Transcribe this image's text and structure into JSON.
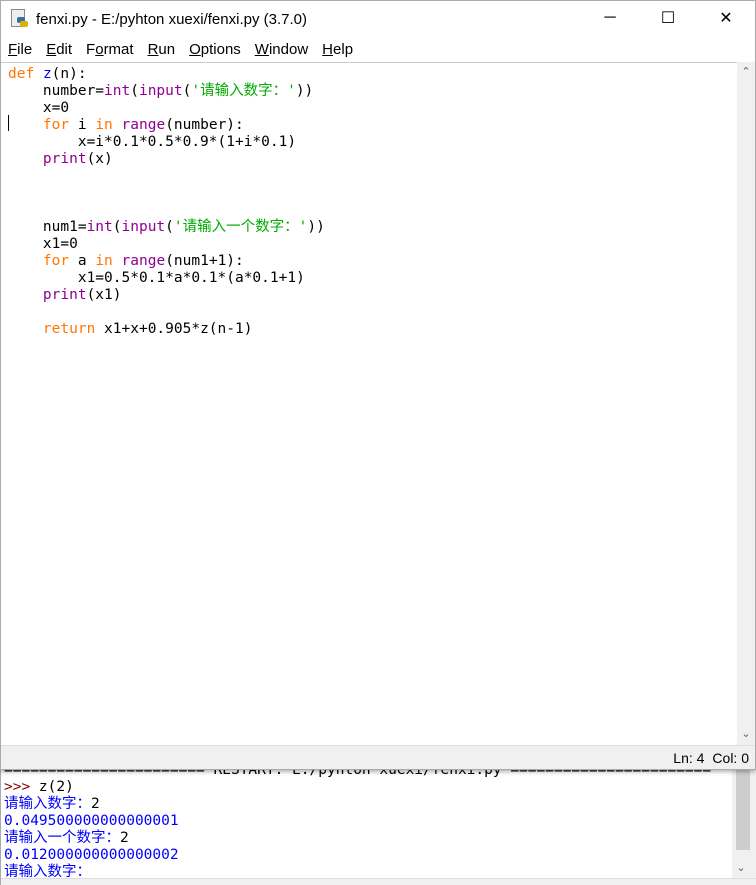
{
  "window": {
    "title": "fenxi.py - E:/pyhton xuexi/fenxi.py (3.7.0)",
    "minimize": "─",
    "maximize": "☐",
    "close": "✕"
  },
  "menu": [
    {
      "u": "F",
      "rest": "ile"
    },
    {
      "u": "E",
      "rest": "dit"
    },
    {
      "pre": "F",
      "u": "o",
      "rest": "rmat"
    },
    {
      "u": "R",
      "rest": "un"
    },
    {
      "u": "O",
      "rest": "ptions"
    },
    {
      "u": "W",
      "rest": "indow"
    },
    {
      "u": "H",
      "rest": "elp"
    }
  ],
  "code": [
    [
      [
        "def",
        "kw"
      ],
      [
        " ",
        ""
      ],
      [
        "z",
        "df"
      ],
      [
        "(n):",
        ""
      ]
    ],
    [
      [
        "    number=",
        ""
      ],
      [
        "int",
        "bi"
      ],
      [
        "(",
        ""
      ],
      [
        "input",
        "bi"
      ],
      [
        "(",
        ""
      ],
      [
        "'请输入数字：'",
        "st"
      ],
      [
        "))",
        ""
      ]
    ],
    [
      [
        "    x=0",
        ""
      ]
    ],
    [
      [
        "    ",
        ""
      ],
      [
        "for",
        "kw"
      ],
      [
        " i ",
        ""
      ],
      [
        "in",
        "kw"
      ],
      [
        " ",
        ""
      ],
      [
        "range",
        "bi"
      ],
      [
        "(number):",
        ""
      ]
    ],
    [
      [
        "        x=i*0.1*0.5*0.9*(1+i*0.1)",
        ""
      ]
    ],
    [
      [
        "    ",
        ""
      ],
      [
        "print",
        "bi"
      ],
      [
        "(x)",
        ""
      ]
    ],
    [
      [
        "",
        ""
      ]
    ],
    [
      [
        "",
        ""
      ]
    ],
    [
      [
        "",
        ""
      ]
    ],
    [
      [
        "    num1=",
        ""
      ],
      [
        "int",
        "bi"
      ],
      [
        "(",
        ""
      ],
      [
        "input",
        "bi"
      ],
      [
        "(",
        ""
      ],
      [
        "'请输入一个数字：'",
        "st"
      ],
      [
        "))",
        ""
      ]
    ],
    [
      [
        "    x1=0",
        ""
      ]
    ],
    [
      [
        "    ",
        ""
      ],
      [
        "for",
        "kw"
      ],
      [
        " a ",
        ""
      ],
      [
        "in",
        "kw"
      ],
      [
        " ",
        ""
      ],
      [
        "range",
        "bi"
      ],
      [
        "(num1+1):",
        ""
      ]
    ],
    [
      [
        "        x1=0.5*0.1*a*0.1*(a*0.1+1)",
        ""
      ]
    ],
    [
      [
        "    ",
        ""
      ],
      [
        "print",
        "bi"
      ],
      [
        "(x1)",
        ""
      ]
    ],
    [
      [
        "",
        ""
      ]
    ],
    [
      [
        "    ",
        ""
      ],
      [
        "return",
        "kw"
      ],
      [
        " x1+x+0.905*z(n-1)",
        ""
      ]
    ]
  ],
  "status": {
    "line": "Ln: 4",
    "col": "Col: 0"
  },
  "shell": [
    [
      [
        "======================= RESTART: E:/pyhton xuexi/fenxi.py =======================",
        ""
      ]
    ],
    [
      [
        ">>> ",
        "pr"
      ],
      [
        "z(2)",
        ""
      ]
    ],
    [
      [
        "请输入数字：",
        "out"
      ],
      [
        "2",
        ""
      ]
    ],
    [
      [
        "0.049500000000000001",
        "out"
      ]
    ],
    [
      [
        "请输入一个数字：",
        "out"
      ],
      [
        "2",
        ""
      ]
    ],
    [
      [
        "0.012000000000000002",
        "out"
      ]
    ],
    [
      [
        "请输入数字：",
        "out"
      ]
    ]
  ],
  "colors": {
    "keyword": "#ff7700",
    "builtin": "#900090",
    "string": "#00aa00",
    "definition": "#0000ff",
    "output": "#0000ff",
    "prompt": "#800000"
  }
}
